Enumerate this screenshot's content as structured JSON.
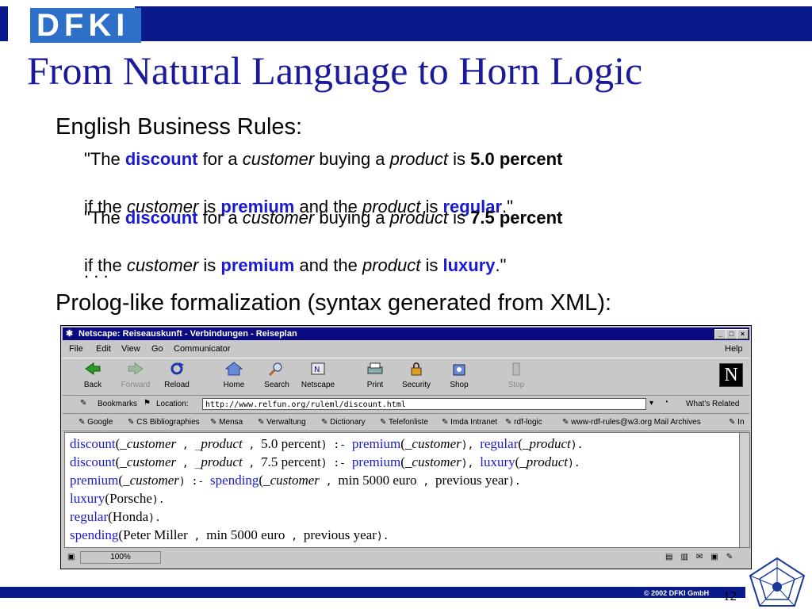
{
  "logo": {
    "text": "DFKI"
  },
  "slide": {
    "title": "From Natural Language to Horn Logic",
    "heading1": "English Business Rules:",
    "rule1": {
      "q_open": "\"The ",
      "k1": "discount",
      "t1": " for a ",
      "i1": "customer",
      "t2": " buying a ",
      "i2": "product",
      "t3": " is ",
      "b1": "5.0 percent",
      "t4": "if the ",
      "i3": "customer",
      "t5": " is ",
      "k2": "premium",
      "t6": " and the ",
      "i4": "product",
      "t7": " is ",
      "k3": "regular",
      "q_close": ".\""
    },
    "rule2": {
      "q_open": "\"The ",
      "k1": "discount",
      "t1": " for a ",
      "i1": "customer",
      "t2": " buying a ",
      "i2": "product",
      "t3": " is ",
      "b1": "7.5 percent",
      "t4": "if the ",
      "i3": "customer",
      "t5": " is ",
      "k2": "premium",
      "t6": " and the ",
      "i4": "product",
      "t7": " is ",
      "k3": "luxury",
      "q_close": ".\""
    },
    "ellipsis": ". . .",
    "heading2": "Prolog-like formalization (syntax generated from XML):",
    "copyright": "© 2002 DFKI GmbH",
    "page_number": "12"
  },
  "browser": {
    "window_title": "Netscape: Reiseauskunft - Verbindungen - Reiseplan",
    "menu": [
      "File",
      "Edit",
      "View",
      "Go",
      "Communicator"
    ],
    "help": "Help",
    "toolbar": {
      "back": "Back",
      "forward": "Forward",
      "reload": "Reload",
      "home": "Home",
      "search": "Search",
      "netscape": "Netscape",
      "print": "Print",
      "security": "Security",
      "shop": "Shop",
      "stop": "Stop"
    },
    "bookmarks_label": "Bookmarks",
    "location_label": "Location:",
    "url": "http://www.relfun.org/ruleml/discount.html",
    "whats_related": "What's Related",
    "personal_bookmarks": [
      "Google",
      "CS Bibliographies",
      "Mensa",
      "Verwaltung",
      "Dictionary",
      "Telefonliste",
      "Imda Intranet",
      "rdf-logic",
      "www-rdf-rules@w3.org Mail Archives",
      "In"
    ],
    "zoom": "100%",
    "content": {
      "l1": {
        "p1": "discount",
        "a1": "(_",
        "v1": "customer",
        "s1": " , _",
        "v2": "product",
        "s2": " , ",
        "v3": "5.0 percent",
        "s3": ")  :-  ",
        "p2": "premium",
        "a2": "(_",
        "v4": "customer",
        "s4": "),  ",
        "p3": "regular",
        "a3": "(_",
        "v5": "product",
        "s5": ")."
      },
      "l2": {
        "p1": "discount",
        "a1": "(_",
        "v1": "customer",
        "s1": " , _",
        "v2": "product",
        "s2": " , ",
        "v3": "7.5 percent",
        "s3": ")  :-  ",
        "p2": "premium",
        "a2": "(_",
        "v4": "customer",
        "s4": "),  ",
        "p3": "luxury",
        "a3": "(_",
        "v5": "product",
        "s5": ")."
      },
      "l3": {
        "p1": "premium",
        "a1": "(_",
        "v1": "customer",
        "s1": ")  :-  ",
        "p2": "spending",
        "a2": "(_",
        "v2": "customer",
        "s2": " , ",
        "v3": "min 5000 euro",
        "s3": " , ",
        "v4": "previous year",
        "s4": ")."
      },
      "l4": {
        "p1": "luxury",
        "a1": "(",
        "v1": "Porsche",
        "s1": ")."
      },
      "l5": {
        "p1": "regular",
        "a1": "(",
        "v1": "Honda",
        "s1": ")."
      },
      "l6": {
        "p1": "spending",
        "a1": "(",
        "v1": "Peter Miller",
        "s1": " , ",
        "v2": "min 5000 euro",
        "s2": " , ",
        "v3": "previous year",
        "s3": ")."
      }
    }
  },
  "colors": {
    "title_blue": "#1a1a9a",
    "bar_blue": "#0a1a8a",
    "keyword_blue": "#1a1ad0"
  }
}
